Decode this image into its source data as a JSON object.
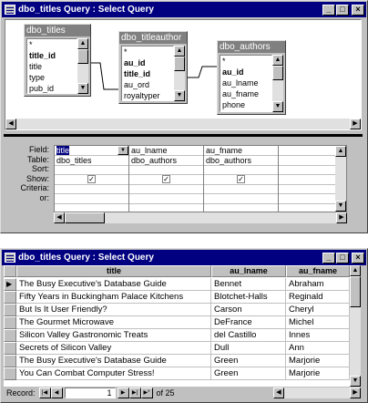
{
  "top_window": {
    "title": "dbo_titles Query : Select Query",
    "tables": [
      {
        "name": "dbo_titles",
        "fields": [
          {
            "label": "*",
            "bold": false
          },
          {
            "label": "title_id",
            "bold": true
          },
          {
            "label": "title",
            "bold": false
          },
          {
            "label": "type",
            "bold": false
          },
          {
            "label": "pub_id",
            "bold": false
          }
        ]
      },
      {
        "name": "dbo_titleauthor",
        "fields": [
          {
            "label": "*",
            "bold": false
          },
          {
            "label": "au_id",
            "bold": true
          },
          {
            "label": "title_id",
            "bold": true
          },
          {
            "label": "au_ord",
            "bold": false
          },
          {
            "label": "royaltyper",
            "bold": false
          }
        ]
      },
      {
        "name": "dbo_authors",
        "fields": [
          {
            "label": "*",
            "bold": false
          },
          {
            "label": "au_id",
            "bold": true
          },
          {
            "label": "au_lname",
            "bold": false
          },
          {
            "label": "au_fname",
            "bold": false
          },
          {
            "label": "phone",
            "bold": false
          }
        ]
      }
    ],
    "grid": {
      "row_labels": [
        "Field:",
        "Table:",
        "Sort:",
        "Show:",
        "Criteria:",
        "or:"
      ],
      "columns": [
        {
          "field": "title",
          "table": "dbo_titles",
          "show": true
        },
        {
          "field": "au_lname",
          "table": "dbo_authors",
          "show": true
        },
        {
          "field": "au_fname",
          "table": "dbo_authors",
          "show": true
        }
      ]
    }
  },
  "bottom_window": {
    "title": "dbo_titles Query : Select Query",
    "headers": [
      "title",
      "au_lname",
      "au_fname"
    ],
    "rows": [
      [
        "The Busy Executive's Database Guide",
        "Bennet",
        "Abraham"
      ],
      [
        "Fifty Years in Buckingham Palace Kitchens",
        "Blotchet-Halls",
        "Reginald"
      ],
      [
        "But Is It User Friendly?",
        "Carson",
        "Cheryl"
      ],
      [
        "The Gourmet Microwave",
        "DeFrance",
        "Michel"
      ],
      [
        "Silicon Valley Gastronomic Treats",
        "del Castillo",
        "Innes"
      ],
      [
        "Secrets of Silicon Valley",
        "Dull",
        "Ann"
      ],
      [
        "The Busy Executive's Database Guide",
        "Green",
        "Marjorie"
      ],
      [
        "You Can Combat Computer Stress!",
        "Green",
        "Marjorie"
      ]
    ],
    "nav": {
      "record_label": "Record:",
      "current": "1",
      "of_text": "of 25"
    }
  }
}
